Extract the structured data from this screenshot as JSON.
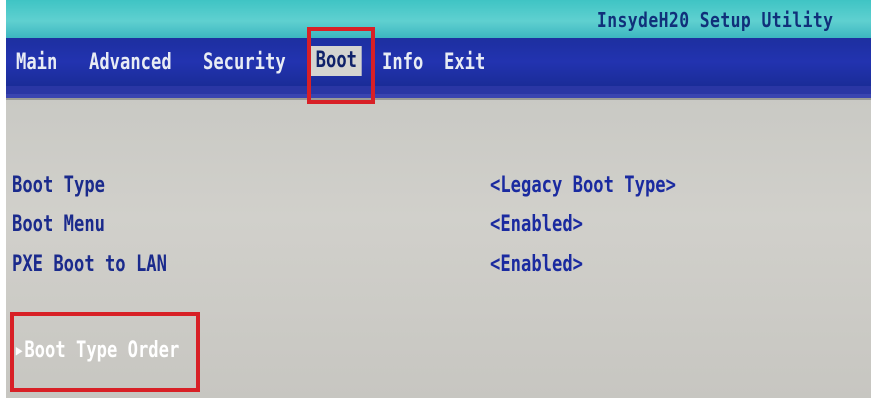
{
  "header": {
    "title": "InsydeH20 Setup Utility"
  },
  "menu": {
    "items": [
      {
        "label": "Main",
        "selected": false
      },
      {
        "label": "Advanced",
        "selected": false
      },
      {
        "label": "Security",
        "selected": false
      },
      {
        "label": "Boot",
        "selected": true
      },
      {
        "label": "Info",
        "selected": false
      },
      {
        "label": "Exit",
        "selected": false
      }
    ]
  },
  "settings": [
    {
      "label": "Boot Type",
      "value": "<Legacy Boot Type>"
    },
    {
      "label": "Boot Menu",
      "value": "<Enabled>"
    },
    {
      "label": "PXE Boot to LAN",
      "value": "<Enabled>"
    }
  ],
  "submenu": {
    "label": "▸Boot Type Order"
  },
  "colors": {
    "title_bar": "#4fcaca",
    "menu_bar": "#1f30a8",
    "content_bg": "#cdccc7",
    "text": "#1a2a8c",
    "highlight_border": "#d82026"
  }
}
